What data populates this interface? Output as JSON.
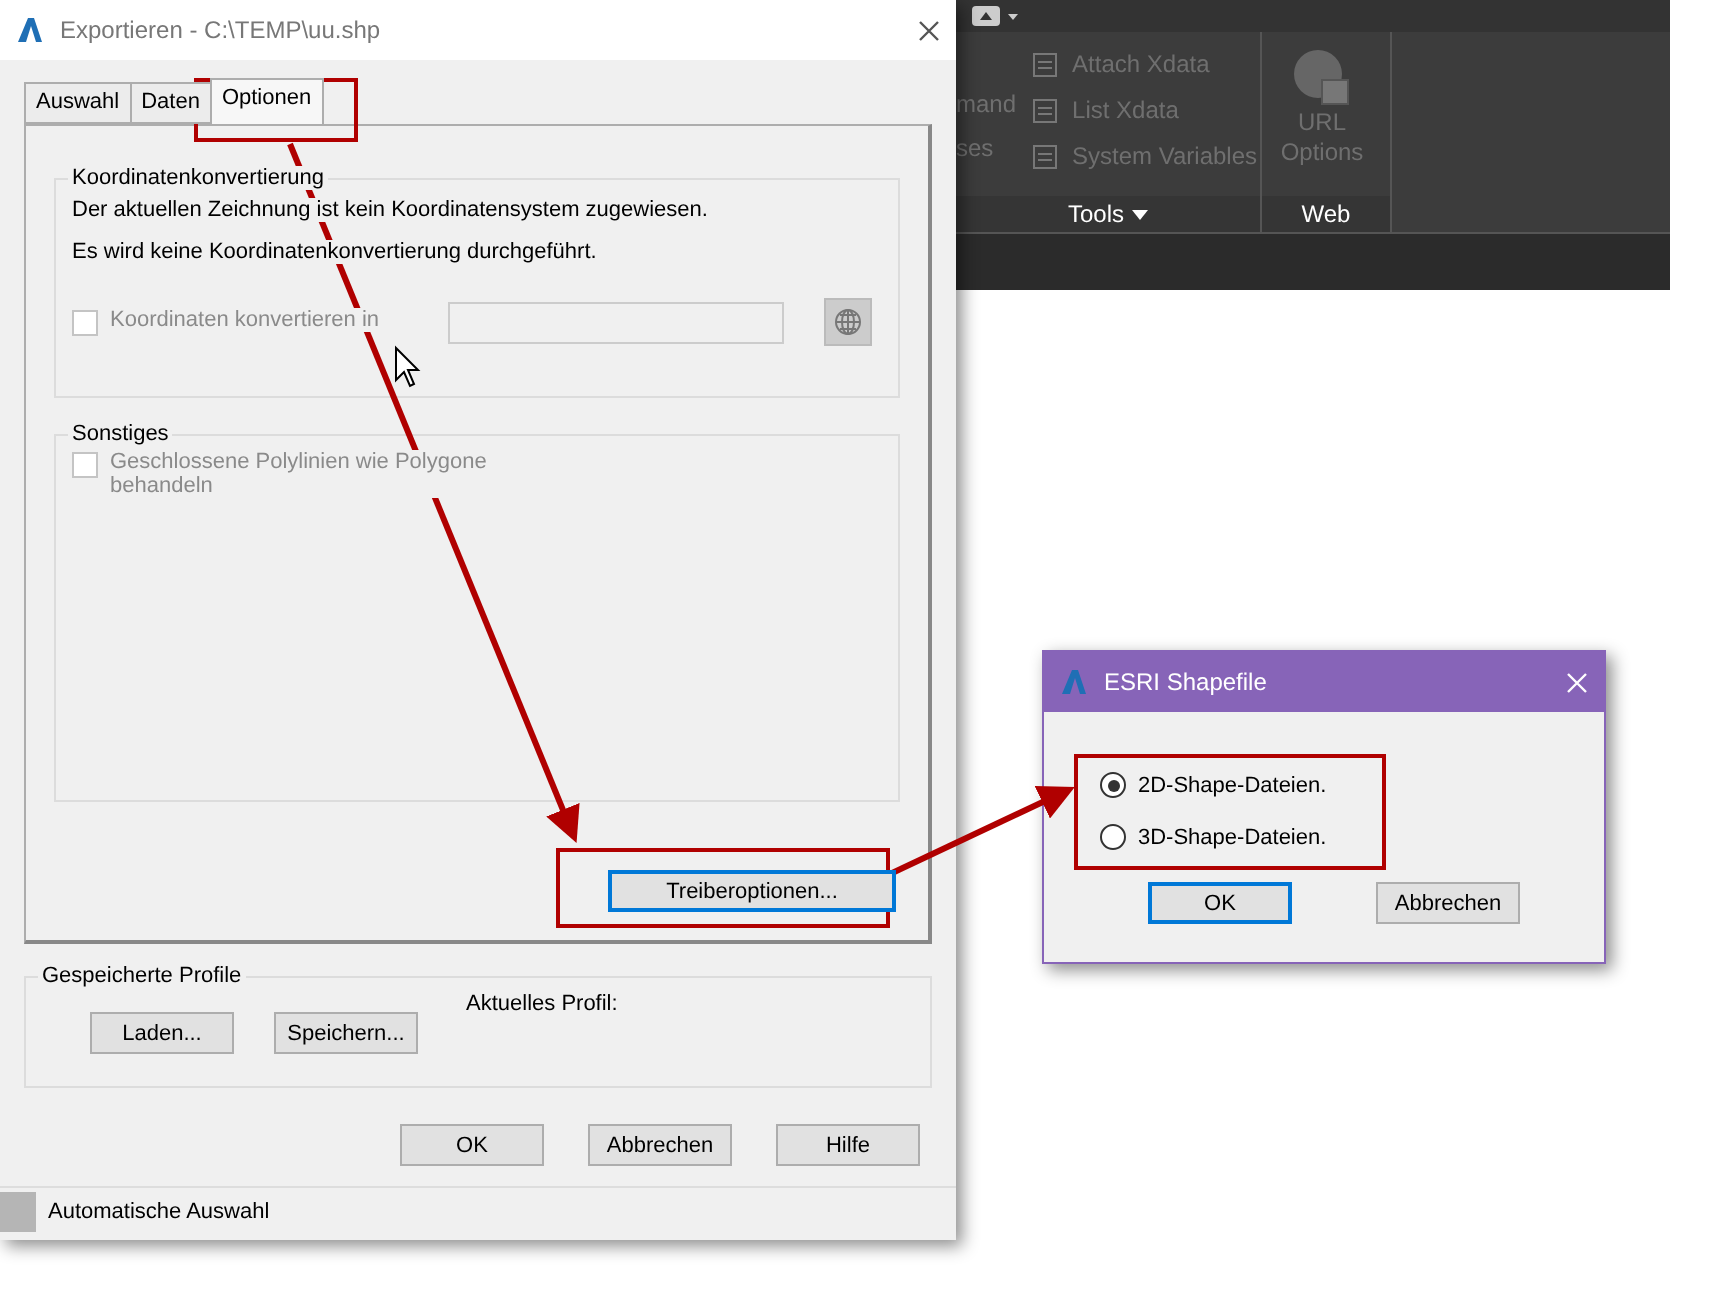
{
  "ribbon": {
    "cut_labels": [
      "mand",
      "ses"
    ],
    "tools": [
      "Attach Xdata",
      "List Xdata",
      "System Variables"
    ],
    "url_button": {
      "label": "URL Options"
    },
    "panels": [
      {
        "label": "Tools",
        "dropdown": true
      },
      {
        "label": "Web",
        "dropdown": false
      }
    ]
  },
  "main_dialog": {
    "title": "Exportieren - C:\\TEMP\\uu.shp",
    "tabs": [
      {
        "label": "Auswahl",
        "selected": false
      },
      {
        "label": "Daten",
        "selected": false
      },
      {
        "label": "Optionen",
        "selected": true
      }
    ],
    "coordinate_group": {
      "title": "Koordinatenkonvertierung",
      "lines": [
        "Der aktuellen Zeichnung ist kein Koordinatensystem zugewiesen.",
        "Es wird keine Koordinatenkonvertierung durchgeführt."
      ],
      "checkbox": {
        "label": "Koordinaten konvertieren in",
        "checked": false,
        "disabled": true
      }
    },
    "other_group": {
      "title": "Sonstiges",
      "checkbox": {
        "label": "Geschlossene Polylinien wie Polygone behandeln",
        "checked": false,
        "disabled": true
      }
    },
    "driver_button": "Treiberoptionen...",
    "profiles": {
      "title": "Gespeicherte Profile",
      "buttons": [
        "Laden...",
        "Speichern..."
      ],
      "current_label": "Aktuelles Profil:"
    },
    "buttons": [
      "OK",
      "Abbrechen",
      "Hilfe"
    ],
    "status": "Automatische Auswahl"
  },
  "esri_dialog": {
    "title": "ESRI Shapefile",
    "options": [
      {
        "label": "2D-Shape-Dateien.",
        "selected": true
      },
      {
        "label": "3D-Shape-Dateien.",
        "selected": false
      }
    ],
    "buttons": [
      {
        "label": "OK",
        "default": true
      },
      {
        "label": "Abbrechen",
        "default": false
      }
    ]
  }
}
